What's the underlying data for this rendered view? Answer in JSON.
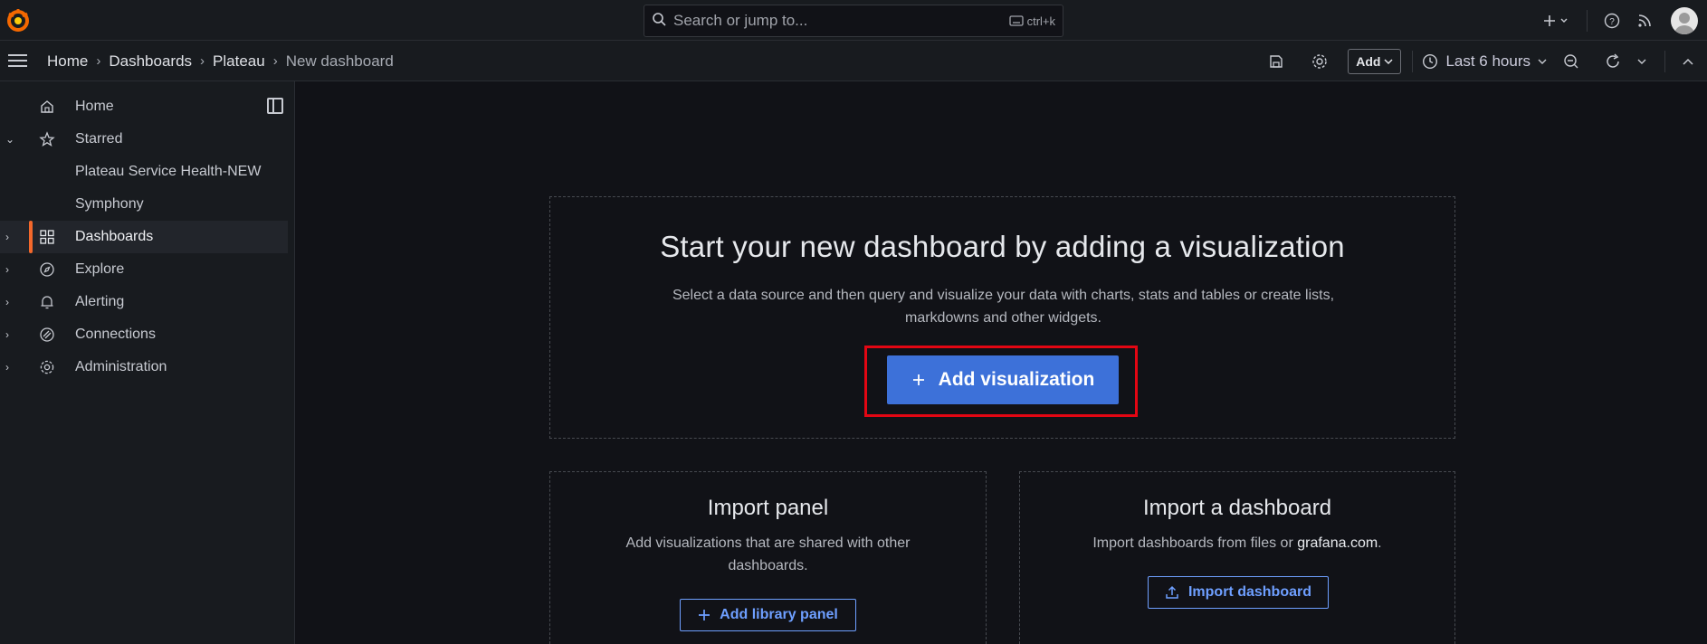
{
  "search": {
    "placeholder": "Search or jump to...",
    "shortcut": "ctrl+k"
  },
  "breadcrumbs": [
    "Home",
    "Dashboards",
    "Plateau",
    "New dashboard"
  ],
  "toolbar": {
    "add_label": "Add",
    "time_range": "Last 6 hours"
  },
  "sidebar": {
    "items": [
      {
        "label": "Home",
        "icon": "home-icon"
      },
      {
        "label": "Starred",
        "icon": "star-icon"
      },
      {
        "label": "Plateau Service Health-NEW"
      },
      {
        "label": "Symphony"
      },
      {
        "label": "Dashboards",
        "icon": "grid-icon"
      },
      {
        "label": "Explore",
        "icon": "compass-icon"
      },
      {
        "label": "Alerting",
        "icon": "bell-icon"
      },
      {
        "label": "Connections",
        "icon": "connections-icon"
      },
      {
        "label": "Administration",
        "icon": "gear-icon"
      }
    ]
  },
  "main": {
    "title": "Start your new dashboard by adding a visualization",
    "description_line1": "Select a data source and then query and visualize your data with charts, stats and tables or create lists,",
    "description_line2": "markdowns and other widgets.",
    "primary_button": "Add visualization",
    "import_panel": {
      "title": "Import panel",
      "description_line1": "Add visualizations that are shared with other",
      "description_line2": "dashboards.",
      "button": "Add library panel"
    },
    "import_dashboard": {
      "title": "Import a dashboard",
      "description": "Import dashboards from files or",
      "link": "grafana.com",
      "link_suffix": ".",
      "button": "Import dashboard"
    }
  },
  "colors": {
    "accent": "#3d71d9",
    "highlight": "#e30613",
    "active_bar": "#f4682b",
    "link": "#6e9fff"
  }
}
